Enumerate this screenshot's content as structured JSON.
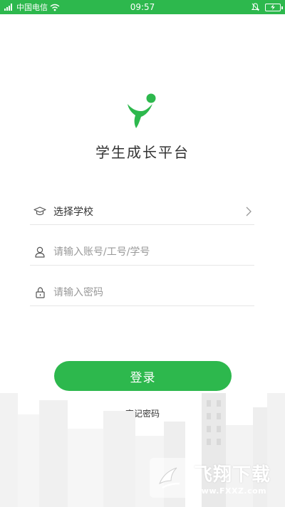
{
  "status_bar": {
    "carrier": "中国电信",
    "time": "09:57"
  },
  "app": {
    "title": "学生成长平台"
  },
  "form": {
    "school_label": "选择学校",
    "account_placeholder": "请输入账号/工号/学号",
    "password_placeholder": "请输入密码"
  },
  "actions": {
    "login_label": "登录",
    "forgot_label": "忘记密码"
  },
  "watermark": {
    "cn": "飞翔下载",
    "url": "www.FXXZ.com"
  },
  "colors": {
    "brand": "#2db84d",
    "text": "#333333",
    "placeholder": "#999999"
  }
}
